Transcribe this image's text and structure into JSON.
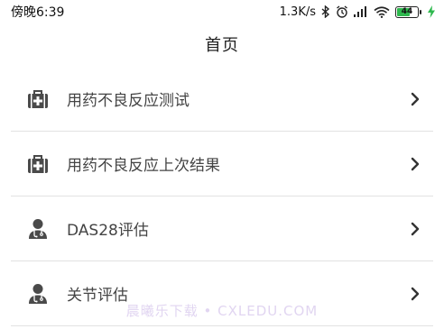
{
  "status_bar": {
    "time": "傍晚6:39",
    "network_speed": "1.3K/s",
    "battery_level": "44",
    "icons": [
      "bluetooth-icon",
      "alarm-icon",
      "signal-icon",
      "wifi-icon",
      "battery-icon",
      "charging-icon"
    ]
  },
  "header": {
    "title": "首页"
  },
  "menu": {
    "items": [
      {
        "label": "用药不良反应测试",
        "icon": "medical-kit-icon"
      },
      {
        "label": "用药不良反应上次结果",
        "icon": "medical-kit-icon"
      },
      {
        "label": "DAS28评估",
        "icon": "doctor-icon"
      },
      {
        "label": "关节评估",
        "icon": "doctor-icon"
      }
    ]
  },
  "watermark": {
    "text": "晨曦乐下载 • CXLEDU.COM"
  },
  "colors": {
    "icon": "#4a4a4a",
    "divider": "#e2e2e2",
    "battery_fill": "#2db84d"
  }
}
